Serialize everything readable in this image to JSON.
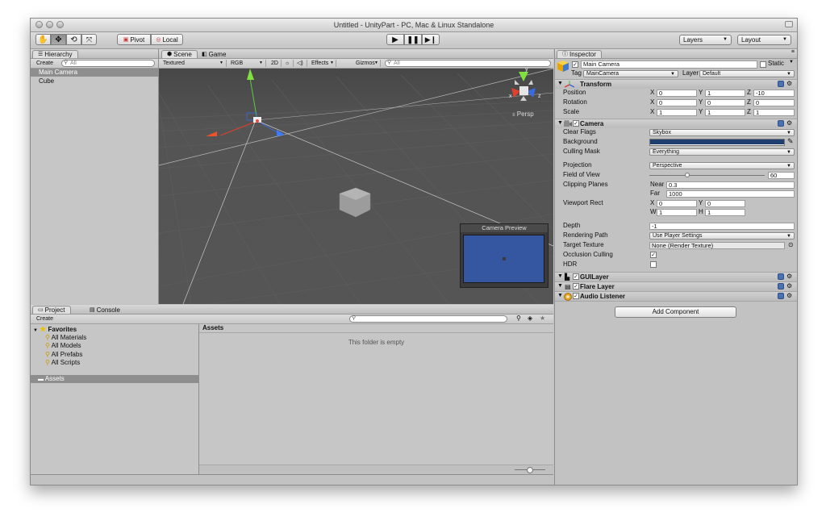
{
  "window": {
    "title": "Untitled - UnityPart - PC, Mac & Linux Standalone"
  },
  "toolbar": {
    "pivot_label": "Pivot",
    "local_label": "Local",
    "layers_label": "Layers",
    "layout_label": "Layout"
  },
  "hierarchy": {
    "tab_label": "Hierarchy",
    "create_label": "Create",
    "search_placeholder": "All",
    "items": [
      "Main Camera",
      "Cube"
    ]
  },
  "scene": {
    "tab_scene": "Scene",
    "tab_game": "Game",
    "draw_mode": "Textured",
    "color_mode": "RGB",
    "mode_2d": "2D",
    "effects_label": "Effects",
    "gizmos_label": "Gizmos",
    "search_placeholder": "All",
    "persp_label": "Persp",
    "gizmo_axes": {
      "x": "x",
      "y": "y",
      "z": "z"
    },
    "camera_preview_title": "Camera Preview"
  },
  "project": {
    "tab_project": "Project",
    "tab_console": "Console",
    "create_label": "Create",
    "favorites_label": "Favorites",
    "favorites": [
      "All Materials",
      "All Models",
      "All Prefabs",
      "All Scripts"
    ],
    "assets_label": "Assets",
    "breadcrumb": "Assets",
    "empty_message": "This folder is empty"
  },
  "inspector": {
    "tab_label": "Inspector",
    "object_name": "Main Camera",
    "static_label": "Static",
    "tag_label": "Tag",
    "tag_value": "MainCamera",
    "layer_label": "Layer",
    "layer_value": "Default",
    "transform": {
      "title": "Transform",
      "rows": [
        {
          "label": "Position",
          "x": "0",
          "y": "1",
          "z": "-10"
        },
        {
          "label": "Rotation",
          "x": "0",
          "y": "0",
          "z": "0"
        },
        {
          "label": "Scale",
          "x": "1",
          "y": "1",
          "z": "1"
        }
      ],
      "axis_x": "X",
      "axis_y": "Y",
      "axis_z": "Z"
    },
    "camera": {
      "title": "Camera",
      "clear_flags_label": "Clear Flags",
      "clear_flags_value": "Skybox",
      "background_label": "Background",
      "background_color": "#1f3f70",
      "culling_mask_label": "Culling Mask",
      "culling_mask_value": "Everything",
      "projection_label": "Projection",
      "projection_value": "Perspective",
      "fov_label": "Field of View",
      "fov_value": "60",
      "fov_fraction": 0.33,
      "clipping_label": "Clipping Planes",
      "near_label": "Near",
      "near_value": "0.3",
      "far_label": "Far",
      "far_value": "1000",
      "viewport_label": "Viewport Rect",
      "vp_x_label": "X",
      "vp_x": "0",
      "vp_y_label": "Y",
      "vp_y": "0",
      "vp_w_label": "W",
      "vp_w": "1",
      "vp_h_label": "H",
      "vp_h": "1",
      "depth_label": "Depth",
      "depth_value": "-1",
      "rendering_path_label": "Rendering Path",
      "rendering_path_value": "Use Player Settings",
      "target_texture_label": "Target Texture",
      "target_texture_value": "None (Render Texture)",
      "occlusion_label": "Occlusion Culling",
      "hdr_label": "HDR"
    },
    "gui_layer": "GUILayer",
    "flare_layer": "Flare Layer",
    "audio_listener": "Audio Listener",
    "add_component_label": "Add Component"
  }
}
